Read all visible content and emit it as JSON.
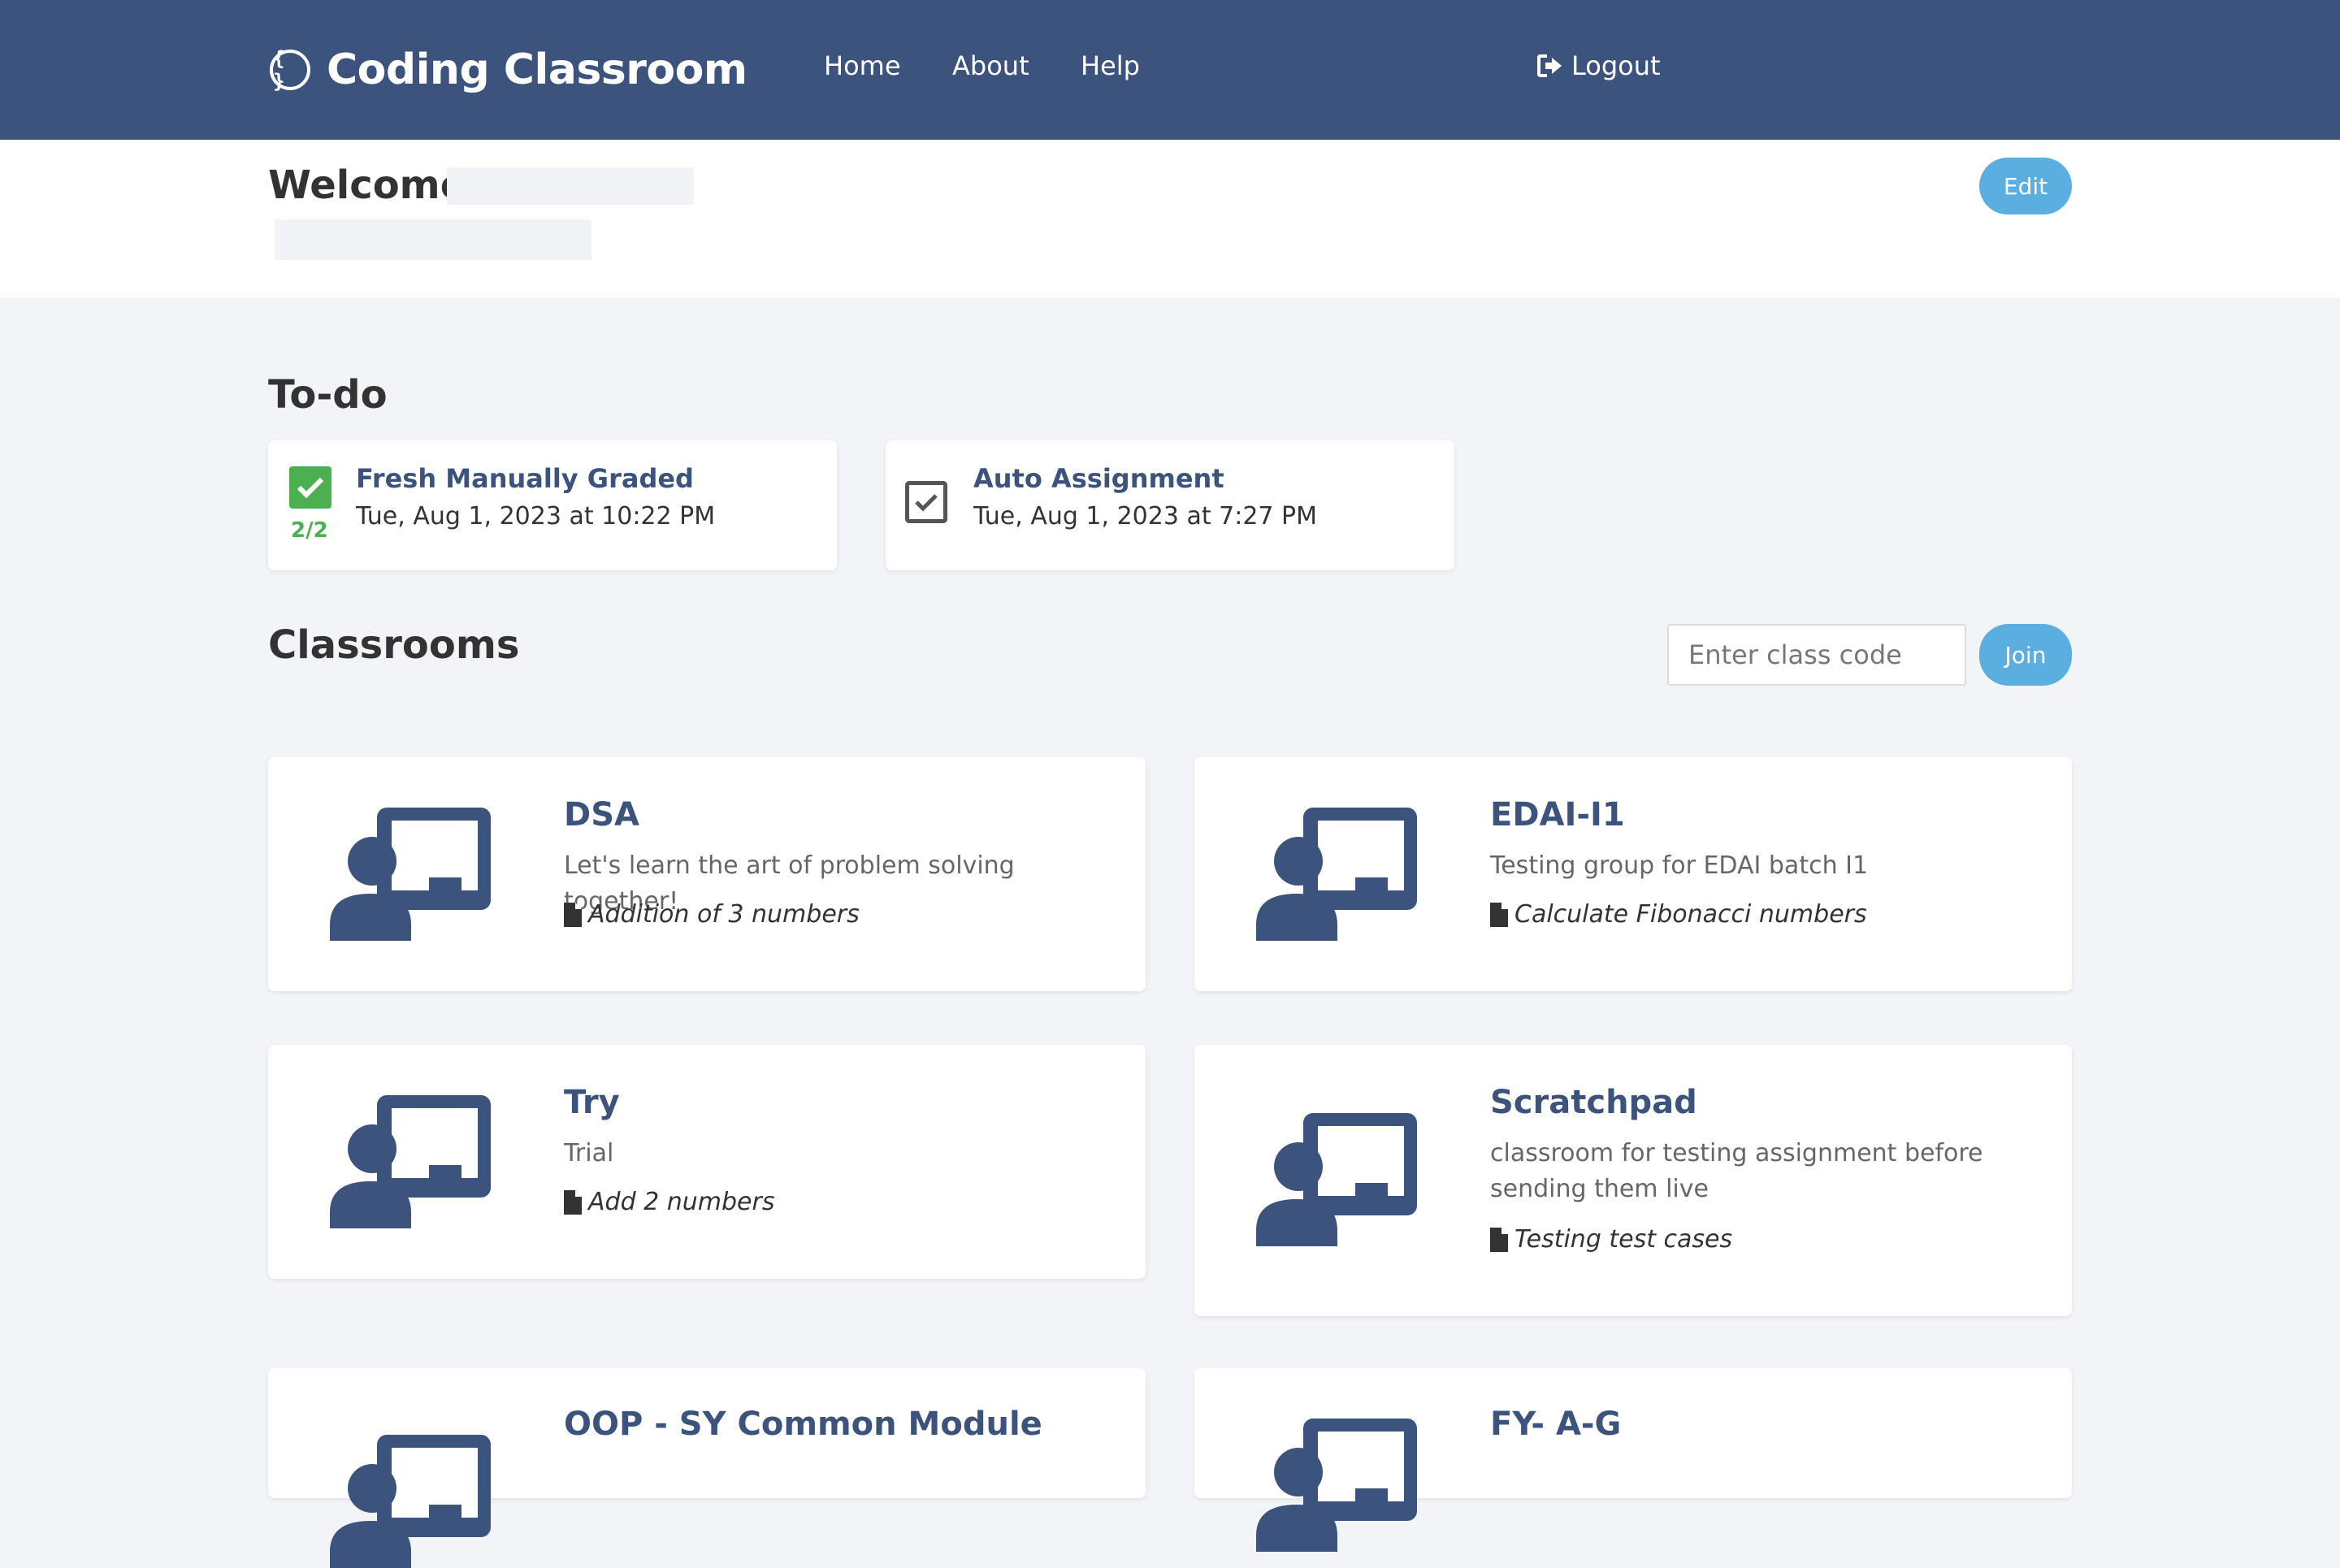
{
  "navbar": {
    "brand": "Coding Classroom",
    "brand_icon": "braces-icon",
    "links": [
      "Home",
      "About",
      "Help"
    ],
    "logout": "Logout"
  },
  "welcome": {
    "greeting": "Welcome,",
    "edit": "Edit"
  },
  "todo": {
    "title": "To-do",
    "items": [
      {
        "title": "Fresh Manually Graded",
        "date": "Tue, Aug 1, 2023 at 10:22 PM",
        "score": "2/2",
        "status": "graded"
      },
      {
        "title": "Auto Assignment",
        "date": "Tue, Aug 1, 2023 at 7:27 PM",
        "status": "submitted"
      }
    ]
  },
  "classrooms": {
    "title": "Classrooms",
    "join_placeholder": "Enter class code",
    "join_label": "Join",
    "items": [
      {
        "name": "DSA",
        "description": "Let's learn the art of problem solving together!",
        "assignment": "Addition of 3 numbers"
      },
      {
        "name": "EDAI-I1",
        "description": "Testing group for EDAI batch I1",
        "assignment": "Calculate Fibonacci numbers"
      },
      {
        "name": "Try",
        "description": "Trial",
        "assignment": "Add 2 numbers"
      },
      {
        "name": "Scratchpad",
        "description": "classroom for testing assignment before sending them live",
        "assignment": "Testing test cases"
      },
      {
        "name": "OOP - SY Common Module",
        "description": "",
        "assignment": ""
      },
      {
        "name": "FY- A-G",
        "description": "",
        "assignment": ""
      }
    ]
  },
  "colors": {
    "navbar": "#3c537e",
    "accent": "#5aaee0",
    "success": "#4caf50",
    "background": "#f3f4f8"
  }
}
